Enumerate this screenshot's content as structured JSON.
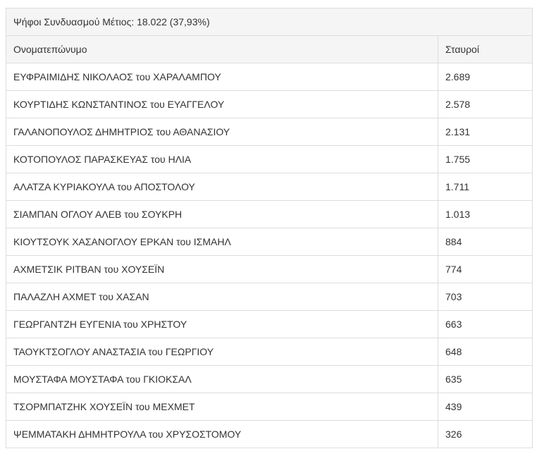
{
  "table": {
    "caption": "Ψήφοι Συνδυασμού Μέτιος: 18.022 (37,93%)",
    "headers": {
      "name": "Ονοματεπώνυμο",
      "votes": "Σταυροί"
    },
    "rows": [
      {
        "name": "ΕΥΦΡΑΙΜΙΔΗΣ ΝΙΚΟΛΑΟΣ του ΧΑΡΑΛΑΜΠΟΥ",
        "votes": "2.689"
      },
      {
        "name": "ΚΟΥΡΤΙΔΗΣ ΚΩΝΣΤΑΝΤΙΝΟΣ του ΕΥΑΓΓΕΛΟΥ",
        "votes": "2.578"
      },
      {
        "name": "ΓΑΛΑΝΟΠΟΥΛΟΣ ΔΗΜΗΤΡΙΟΣ του ΑΘΑΝΑΣΙΟΥ",
        "votes": "2.131"
      },
      {
        "name": "ΚΟΤΟΠΟΥΛΟΣ ΠΑΡΑΣΚΕΥΑΣ του ΗΛΙΑ",
        "votes": "1.755"
      },
      {
        "name": "ΑΛΑΤΖΑ ΚΥΡΙΑΚΟΥΛΑ του ΑΠΟΣΤΟΛΟΥ",
        "votes": "1.711"
      },
      {
        "name": "ΣΙΑΜΠΑΝ ΟΓΛΟΥ ΑΛΕΒ του ΣΟΥΚΡΗ",
        "votes": "1.013"
      },
      {
        "name": "ΚΙΟΥΤΣΟΥΚ ΧΑΣΑΝΟΓΛΟΥ ΕΡΚΑΝ του ΙΣΜΑΗΛ",
        "votes": "884"
      },
      {
        "name": "ΑΧΜΕΤΣΙΚ ΡΙΤΒΑΝ του ΧΟΥΣΕΪΝ",
        "votes": "774"
      },
      {
        "name": "ΠΑΛΑΖΛΗ ΑΧΜΕΤ του ΧΑΣΑΝ",
        "votes": "703"
      },
      {
        "name": "ΓΕΩΡΓΑΝΤΖΗ ΕΥΓΕΝΙΑ του ΧΡΗΣΤΟΥ",
        "votes": "663"
      },
      {
        "name": "ΤΑΟΥΚΤΣΟΓΛΟΥ ΑΝΑΣΤΑΣΙΑ του ΓΕΩΡΓΙΟΥ",
        "votes": "648"
      },
      {
        "name": "ΜΟΥΣΤΑΦΑ ΜΟΥΣΤΑΦΑ του ΓΚΙΟΚΣΑΛ",
        "votes": "635"
      },
      {
        "name": "ΤΣΟΡΜΠΑΤΖΗΚ ΧΟΥΣΕΪΝ του ΜΕΧΜΕΤ",
        "votes": "439"
      },
      {
        "name": "ΨΕΜΜΑΤΑΚΗ ΔΗΜΗΤΡΟΥΛΑ του ΧΡΥΣΟΣΤΟΜΟΥ",
        "votes": "326"
      }
    ]
  }
}
